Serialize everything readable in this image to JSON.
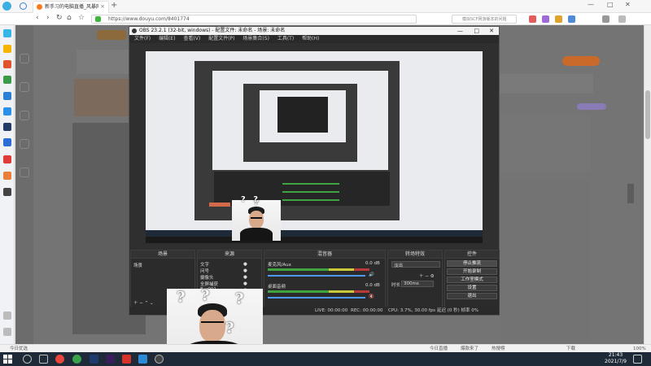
{
  "browser": {
    "tabs": [
      {
        "label": "新手习的电脑直播_风暴网络技巧_"
      }
    ],
    "url": "https://www.douyu.com/8401774",
    "search_placeholder": "模拟SCF网游版本的问题"
  },
  "obs": {
    "title": "OBS 23.2.1 (32-bit, windows) - 配置文件: 未命名 - 场景: 未命名",
    "menu": [
      "文件(F)",
      "编辑(E)",
      "查看(V)",
      "配置文件(P)",
      "场景集合(S)",
      "工具(T)",
      "帮助(H)"
    ],
    "docks": {
      "scenes": {
        "title": "场景",
        "items": [
          "场景"
        ]
      },
      "sources": {
        "title": "来源",
        "items": [
          "文字",
          "问号",
          "摄像头",
          "全屏捕获",
          "Bar001"
        ]
      },
      "mixer": {
        "title": "混音器",
        "tracks": [
          {
            "name": "麦克风/Aux",
            "db": "0.0 dB"
          },
          {
            "name": "桌面音频",
            "db": "0.0 dB"
          }
        ]
      },
      "transitions": {
        "title": "转场特效",
        "type": "淡出",
        "duration_label": "时长",
        "duration": "300ms"
      },
      "controls": {
        "title": "控件",
        "buttons": [
          "停止推流",
          "开始录制",
          "工作室模式",
          "设置",
          "退出"
        ]
      }
    },
    "status": {
      "live": "LIVE: 00:00:00",
      "rec": "REC: 00:00:00",
      "cpu": "CPU: 3.7%, 30.00 fps",
      "net": "延迟 (0 秒) 帧率 0%"
    }
  },
  "overlay": {
    "marks": [
      "?",
      "?",
      "?",
      "?"
    ]
  },
  "statusbar": {
    "left": "今日优选",
    "right_items": [
      "今日直播",
      "爆款来了",
      "热搜榜",
      "下载",
      "100%"
    ]
  },
  "taskbar": {
    "time": "21:43",
    "date": "2021/7/9"
  }
}
